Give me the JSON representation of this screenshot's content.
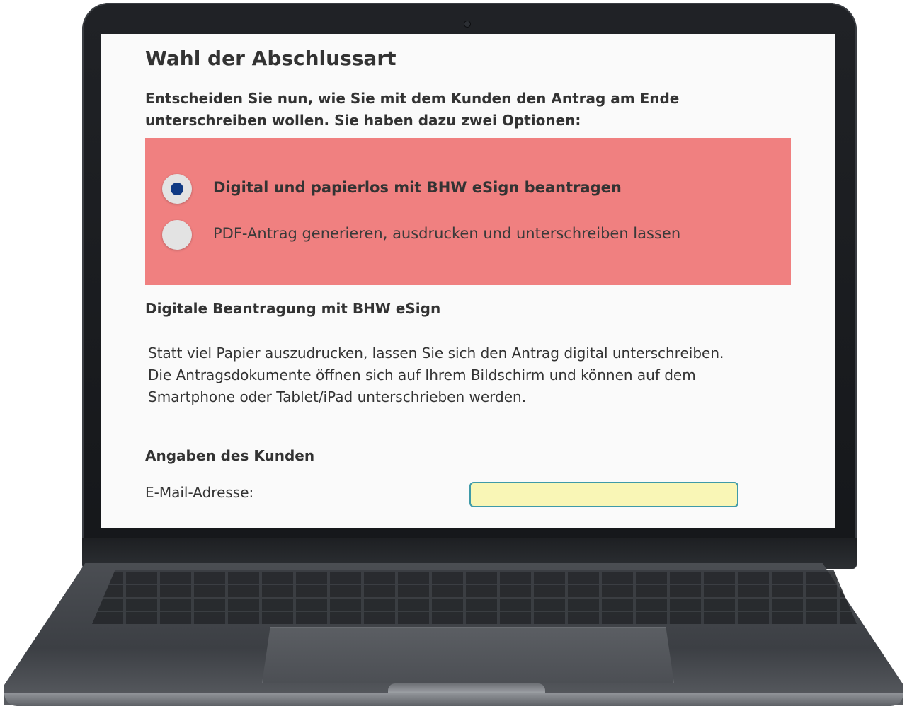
{
  "page": {
    "title": "Wahl der Abschlussart",
    "intro": "Entscheiden Sie nun, wie Sie mit dem Kunden den Antrag am Ende unterschreiben wollen. Sie haben dazu zwei Optionen:"
  },
  "signing_options": {
    "items": [
      {
        "label": "Digital und papierlos mit BHW eSign beantragen",
        "selected": true
      },
      {
        "label": "PDF-Antrag generieren, ausdrucken und unterschreiben lassen",
        "selected": false
      }
    ],
    "box_color": "#f08080",
    "selected_dot_color": "#103a84"
  },
  "digital_section": {
    "heading": "Digitale Beantragung mit BHW eSign",
    "description": "Statt viel Papier auszudrucken, lassen Sie sich den Antrag digital unterschreiben. Die Antragsdokumente öffnen sich auf Ihrem Bildschirm und können auf dem Smartphone oder Tablet/iPad unterschrieben werden."
  },
  "customer_section": {
    "heading": "Angaben des Kunden",
    "email_label": "E-Mail-Adresse:",
    "email_value": ""
  }
}
